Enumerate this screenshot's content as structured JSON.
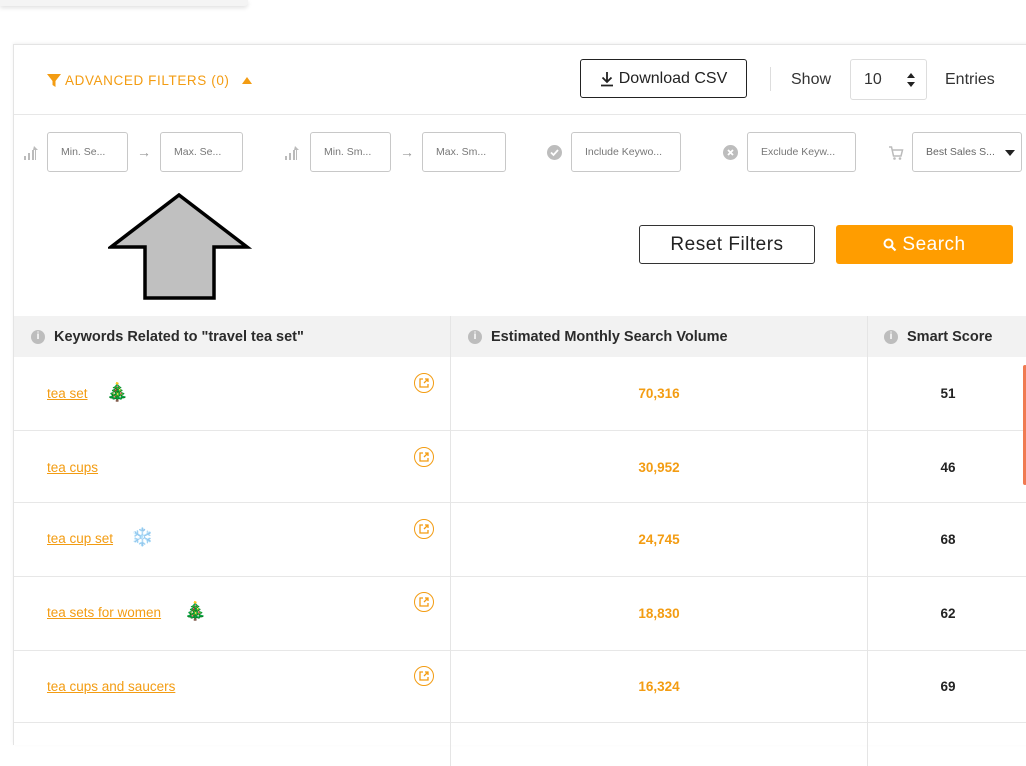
{
  "toolbar": {
    "advanced_filters_label": "ADVANCED FILTERS (0)",
    "download_label": "Download CSV",
    "show_label": "Show",
    "entries_value": "10",
    "entries_label": "Entries"
  },
  "filters": {
    "min_search_placeholder": "Min. Se...",
    "max_search_placeholder": "Max. Se...",
    "min_smart_placeholder": "Min. Sm...",
    "max_smart_placeholder": "Max. Sm...",
    "include_keywords_placeholder": "Include Keywo...",
    "exclude_keywords_placeholder": "Exclude Keyw...",
    "best_sales_value": "Best Sales S..."
  },
  "actions": {
    "reset_label": "Reset Filters",
    "search_label": "Search"
  },
  "table": {
    "headers": [
      "Keywords Related to \"travel tea set\"",
      "Estimated Monthly Search Volume",
      "Smart Score"
    ],
    "rows": [
      {
        "keyword": "tea set",
        "emoji": "🎄",
        "volume": "70,316",
        "score": "51"
      },
      {
        "keyword": "tea cups",
        "emoji": "",
        "volume": "30,952",
        "score": "46"
      },
      {
        "keyword": "tea cup set",
        "emoji": "❄️",
        "volume": "24,745",
        "score": "68"
      },
      {
        "keyword": "tea sets for women",
        "emoji": "🎄",
        "volume": "18,830",
        "score": "62"
      },
      {
        "keyword": "tea cups and saucers",
        "emoji": "",
        "volume": "16,324",
        "score": "69"
      }
    ]
  },
  "colors": {
    "accent": "#ff9d00",
    "link": "#f39c12",
    "header_bg": "#f2f2f2"
  }
}
